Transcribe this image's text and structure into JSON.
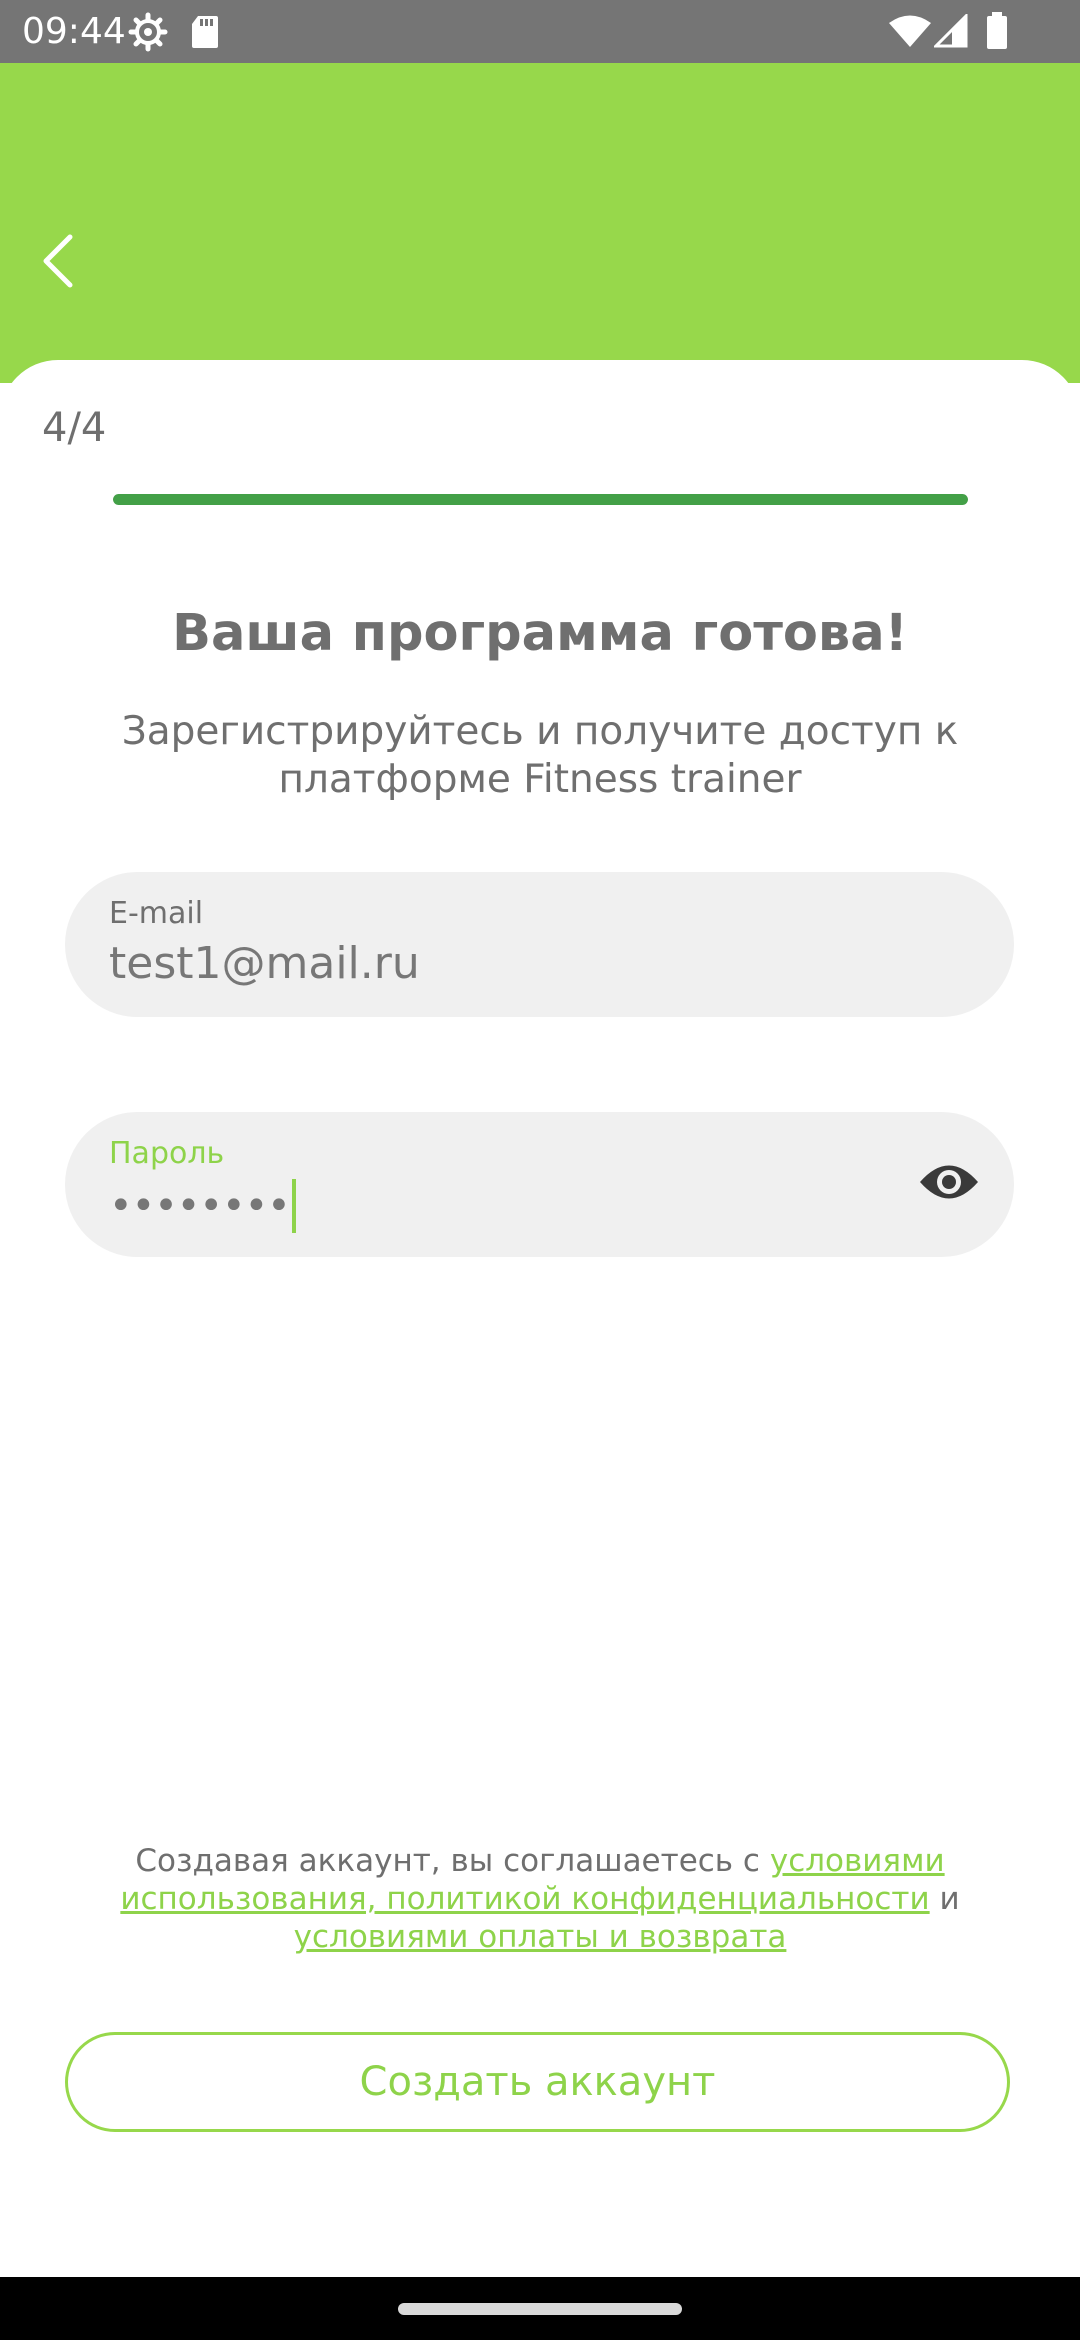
{
  "status_bar": {
    "time": "09:44",
    "icons": [
      "settings-icon",
      "sd-card-icon",
      "wifi-icon",
      "signal-icon",
      "battery-icon"
    ]
  },
  "header": {
    "back_icon": "chevron-left-icon"
  },
  "progress": {
    "step_label": "4/4",
    "fraction": 1.0
  },
  "title": "Ваша программа готова!",
  "subtitle": "Зарегистрируйтесь и получите доступ к платформе Fitness trainer",
  "email_field": {
    "label": "E-mail",
    "value": "test1@mail.ru"
  },
  "password_field": {
    "label": "Пароль",
    "masked_value": "••••••••",
    "toggle_icon": "eye-icon"
  },
  "terms": {
    "prefix": "Создавая аккаунт, вы соглашаетесь с ",
    "link_terms": "условиями использования, политикой конфиденциальности",
    "middle": " и ",
    "link_payment": "условиями оплаты и возврата"
  },
  "create_button": {
    "label": "Создать аккаунт"
  },
  "colors": {
    "accent": "#97d84b",
    "progress": "#43a047",
    "text": "#6f6f6f",
    "field_bg": "#f0f0f0"
  }
}
